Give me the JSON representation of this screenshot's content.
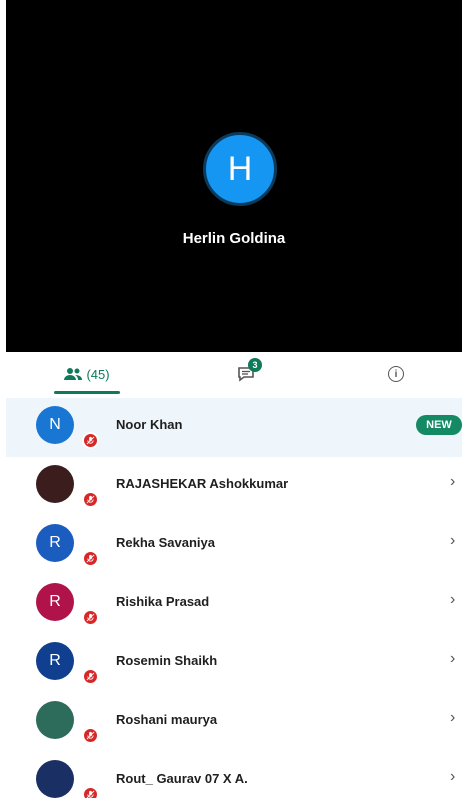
{
  "speaker": {
    "initial": "H",
    "name": "Herlin Goldina"
  },
  "tabs": {
    "participants_label": "(45)",
    "chat_badge": "3",
    "info_symbol": "i"
  },
  "participants": [
    {
      "initial": "N",
      "name": "Noor Khan",
      "avatar_color": "#1976d2",
      "tag": "NEW"
    },
    {
      "initial": "",
      "name": "RAJASHEKAR Ashokkumar",
      "avatar_color": "#3b1d1d"
    },
    {
      "initial": "R",
      "name": "Rekha Savaniya",
      "avatar_color": "#1b5cbf"
    },
    {
      "initial": "R",
      "name": "Rishika Prasad",
      "avatar_color": "#b0134a"
    },
    {
      "initial": "R",
      "name": "Rosemin Shaikh",
      "avatar_color": "#0f3f8e"
    },
    {
      "initial": "",
      "name": "Roshani maurya",
      "avatar_color": "#2d6b5a"
    },
    {
      "initial": "",
      "name": "Rout_ Gaurav 07 X A.",
      "avatar_color": "#1a2f63"
    }
  ],
  "colors": {
    "accent": "#0e7a5a",
    "muted_badge": "#d62828"
  }
}
